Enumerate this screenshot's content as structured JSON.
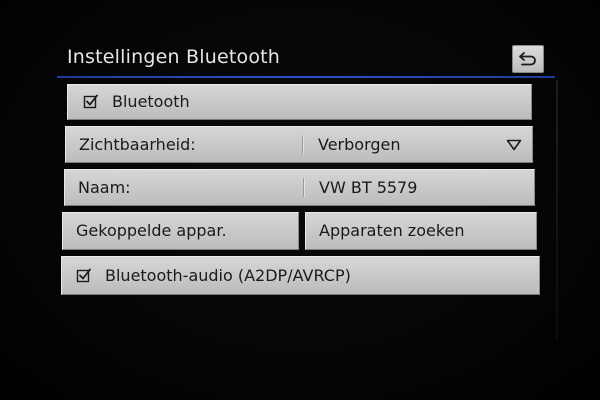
{
  "header": {
    "title": "Instellingen Bluetooth",
    "back_icon": "back-arrow-icon"
  },
  "settings": {
    "bluetooth": {
      "label": "Bluetooth",
      "checked": true
    },
    "visibility": {
      "label": "Zichtbaarheid:",
      "value": "Verborgen",
      "icon": "dropdown-triangle-icon"
    },
    "name": {
      "label": "Naam:",
      "value": "VW BT 5579"
    },
    "paired_devices_label": "Gekoppelde appar.",
    "search_devices_label": "Apparaten zoeken",
    "bluetooth_audio": {
      "label": "Bluetooth-audio (A2DP/AVRCP)",
      "checked": true
    }
  },
  "colors": {
    "accent_rule": "#2d52c8",
    "button_face": "#c9c9c9",
    "background": "#000000"
  }
}
